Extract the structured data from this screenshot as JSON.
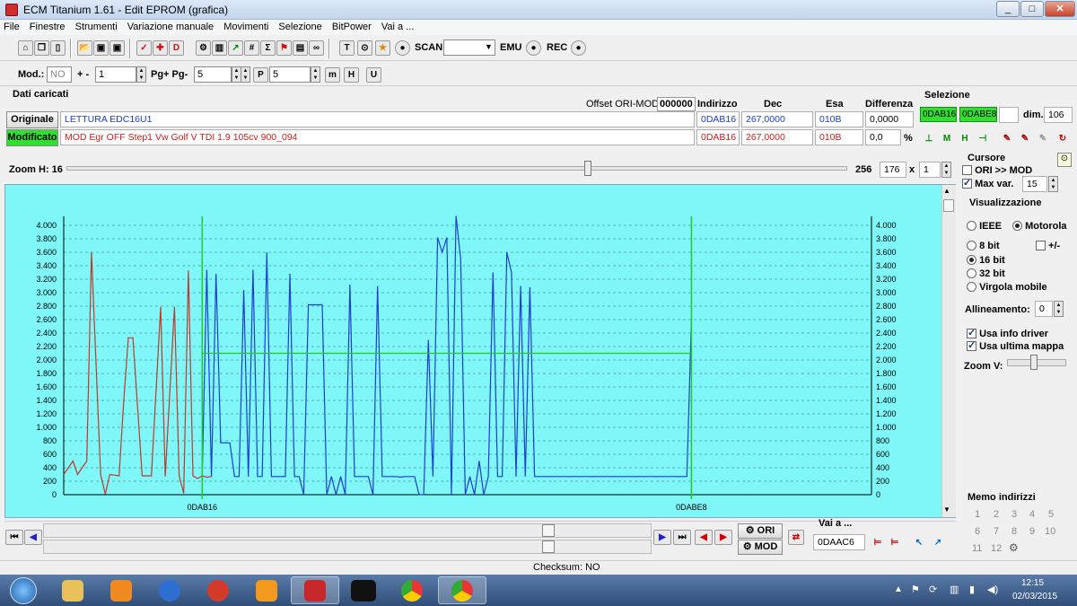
{
  "window": {
    "title": "ECM Titanium 1.61 - Edit EPROM (grafica)",
    "min": "_",
    "max": "□",
    "close": "✕"
  },
  "menu": [
    "File",
    "Finestre",
    "Strumenti",
    "Variazione manuale",
    "Movimenti",
    "Selezione",
    "BitPower",
    "Vai a ..."
  ],
  "toolbar1": {
    "scan_label": "SCAN",
    "scan_value": "",
    "emu_label": "EMU",
    "rec_label": "REC"
  },
  "toolbar2": {
    "mod_label": "Mod.:",
    "mod_value": "NO",
    "plusminus_label": "+ -",
    "plusminus_value": "1",
    "pg_label": "Pg+ Pg-",
    "pg_value": "5",
    "p_value": "5"
  },
  "data_panel": {
    "heading": "Dati caricati",
    "offset_label": "Offset ORI-MOD",
    "offset_value": "000000",
    "col_indirizzo": "Indirizzo",
    "col_dec": "Dec",
    "col_esa": "Esa",
    "col_diff": "Differenza",
    "originale_btn": "Originale",
    "originale_name": "LETTURA EDC16U1",
    "originale_addr": "0DAB16",
    "originale_dec": "267,0000",
    "originale_esa": "010B",
    "originale_diff": "0,0000",
    "modificato_btn": "Modificato",
    "modificato_name": "MOD Egr OFF Step1 Vw Golf V TDI 1.9 105cv 900_094",
    "modificato_addr": "0DAB16",
    "modificato_dec": "267,0000",
    "modificato_esa": "010B",
    "modificato_diff": "0,0",
    "percent": "%"
  },
  "selezione": {
    "heading": "Selezione",
    "start": "0DAB16",
    "end": "0DABE8",
    "blank": "",
    "dim_label": "dim.",
    "dim_value": "106"
  },
  "zoom": {
    "label": "Zoom H: 16",
    "max": "256",
    "value": "176",
    "x": "x",
    "mult": "1"
  },
  "cursore": {
    "heading": "Cursore",
    "ori_mod": "ORI >> MOD",
    "max_var_label": "Max var.",
    "max_var_value": "15"
  },
  "visualizzazione": {
    "heading": "Visualizzazione",
    "ieee": "IEEE",
    "motorola": "Motorola",
    "bit8": "8 bit",
    "plusminus": "+/-",
    "bit16": "16 bit",
    "bit32": "32 bit",
    "virgola": "Virgola mobile",
    "allineamento_label": "Allineamento:",
    "allineamento_value": "0",
    "usa_info": "Usa info driver",
    "usa_ultima": "Usa ultima mappa",
    "zoom_v": "Zoom V:"
  },
  "memo": {
    "heading": "Memo indirizzi",
    "slots": [
      "1",
      "2",
      "3",
      "4",
      "5",
      "6",
      "7",
      "8",
      "9",
      "10",
      "11",
      "12"
    ]
  },
  "bottom": {
    "ori_btn": "ORI",
    "mod_btn": "MOD",
    "vai_label": "Vai a ...",
    "vai_value": "0DAAC6",
    "status": "Checksum: NO"
  },
  "clock": {
    "time": "12:15",
    "date": "02/03/2015"
  },
  "colors": {
    "chart_bg": "#7ff6f8",
    "ori_series": "#c0392b",
    "mod_series": "#1f3fd0",
    "marker": "#22cc22"
  },
  "chart_data": {
    "type": "line",
    "ylim": [
      0,
      4000
    ],
    "yticks": [
      "4.000",
      "3.800",
      "3.600",
      "3.400",
      "3.200",
      "3.000",
      "2.800",
      "2.600",
      "2.400",
      "2.200",
      "2.000",
      "1.800",
      "1.600",
      "1.400",
      "1.200",
      "1.000",
      "800",
      "600",
      "400",
      "200",
      "0"
    ],
    "yvalues": [
      4000,
      3800,
      3600,
      3400,
      3200,
      3000,
      2800,
      2600,
      2400,
      2200,
      2000,
      1800,
      1600,
      1400,
      1200,
      1000,
      800,
      600,
      400,
      200,
      0
    ],
    "xlabels": [
      "0DAB16",
      "0DABE8"
    ],
    "xmarkers": [
      0,
      106
    ],
    "xrange": [
      -30,
      145
    ],
    "series": [
      {
        "name": "Originale",
        "color": "#c0392b",
        "x": [
          -30,
          -28,
          -27,
          -25,
          -24,
          -22,
          -21,
          -20,
          -18,
          -17,
          -16,
          -15,
          -13,
          -11,
          -9,
          -8,
          -6,
          -5,
          -4,
          -3,
          -2,
          -1,
          0,
          1,
          2
        ],
        "y": [
          300,
          500,
          300,
          500,
          3600,
          300,
          10,
          300,
          280,
          1400,
          2330,
          2330,
          280,
          280,
          2790,
          270,
          2790,
          280,
          20,
          3330,
          280,
          240,
          280,
          260,
          270
        ]
      },
      {
        "name": "Modificato",
        "color": "#1f3fd0",
        "x": [
          0,
          1,
          2,
          3,
          4,
          5,
          6,
          7,
          8,
          9,
          10,
          11,
          12,
          13,
          14,
          15,
          16,
          17,
          18,
          19,
          20,
          21,
          22,
          23,
          24,
          25,
          26,
          27,
          28,
          29,
          30,
          31,
          32,
          33,
          34,
          35,
          36,
          37,
          38,
          39,
          40,
          41,
          42,
          43,
          44,
          45,
          46,
          47,
          48,
          49,
          50,
          51,
          52,
          53,
          54,
          55,
          56,
          57,
          58,
          59,
          60,
          61,
          62,
          63,
          64,
          65,
          66,
          67,
          68,
          69,
          70,
          71,
          72,
          73,
          74,
          75,
          76,
          77,
          78,
          79,
          80,
          81,
          82,
          83,
          84,
          85,
          86,
          87,
          88,
          89,
          90,
          91,
          92,
          93,
          94,
          95,
          96,
          97,
          98,
          99,
          100,
          101,
          102,
          103,
          104,
          105,
          106
        ],
        "y": [
          270,
          3340,
          270,
          3280,
          770,
          770,
          770,
          270,
          270,
          3040,
          270,
          3340,
          270,
          270,
          3600,
          270,
          270,
          270,
          270,
          3280,
          270,
          270,
          0,
          2820,
          2820,
          2820,
          2820,
          0,
          270,
          0,
          270,
          0,
          3120,
          270,
          270,
          270,
          270,
          0,
          3100,
          270,
          270,
          270,
          270,
          260,
          270,
          270,
          270,
          0,
          0,
          2300,
          270,
          3820,
          3600,
          3820,
          0,
          4140,
          3500,
          0,
          270,
          0,
          500,
          0,
          270,
          3300,
          270,
          270,
          3600,
          3300,
          270,
          3100,
          270,
          3080,
          270,
          270,
          270,
          270,
          270,
          270,
          270,
          270,
          270,
          270,
          270,
          270,
          270,
          270,
          270,
          270,
          270,
          270,
          270,
          270,
          270,
          270,
          270,
          270,
          270,
          270,
          270,
          270,
          270,
          270,
          270,
          270,
          270,
          270,
          2600
        ]
      }
    ]
  }
}
